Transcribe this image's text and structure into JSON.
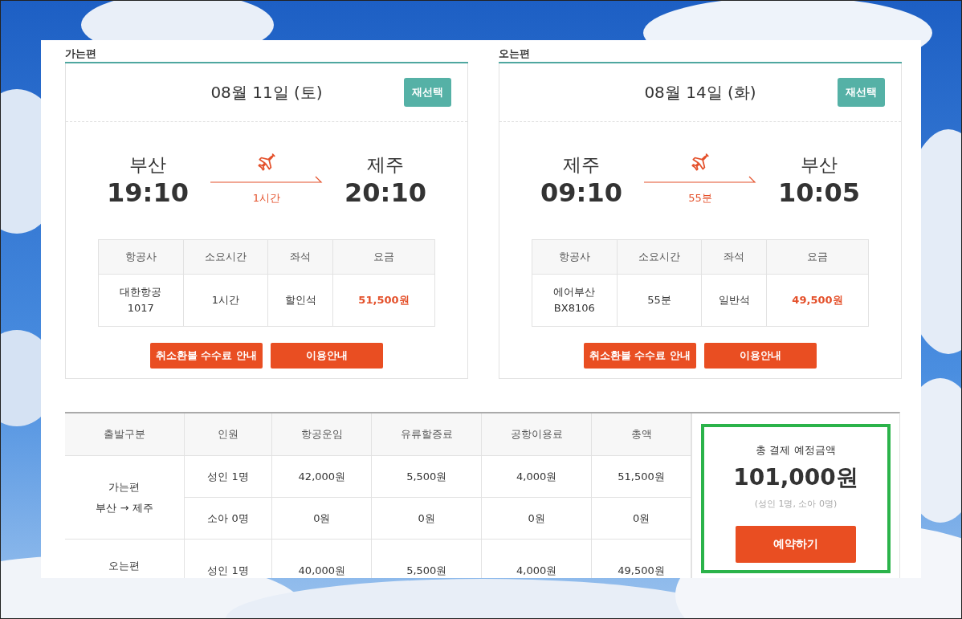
{
  "flights": [
    {
      "section_title": "가는편",
      "date": "08월 11일 (토)",
      "reselect": "재선택",
      "from": "부산",
      "dep_time": "19:10",
      "duration": "1시간",
      "to": "제주",
      "arr_time": "20:10",
      "columns": [
        "항공사",
        "소요시간",
        "좌석",
        "요금"
      ],
      "airline": "대한항공",
      "flight_no": "1017",
      "time": "1시간",
      "seat": "할인석",
      "fare": "51,500원",
      "buttons": [
        "취소환불 수수료 안내",
        "이용안내"
      ]
    },
    {
      "section_title": "오는편",
      "date": "08월 14일 (화)",
      "reselect": "재선택",
      "from": "제주",
      "dep_time": "09:10",
      "duration": "55분",
      "to": "부산",
      "arr_time": "10:05",
      "columns": [
        "항공사",
        "소요시간",
        "좌석",
        "요금"
      ],
      "airline": "에어부산",
      "flight_no": "BX8106",
      "time": "55분",
      "seat": "일반석",
      "fare": "49,500원",
      "buttons": [
        "취소환불 수수료 안내",
        "이용안내"
      ]
    }
  ],
  "fare_table": {
    "columns": [
      "출발구분",
      "인원",
      "항공운임",
      "유류할증료",
      "공항이용료",
      "총액"
    ],
    "groups": [
      {
        "direction": "가는편",
        "route": "부산 → 제주",
        "rows": [
          [
            "성인 1명",
            "42,000원",
            "5,500원",
            "4,000원",
            "51,500원"
          ],
          [
            "소아 0명",
            "0원",
            "0원",
            "0원",
            "0원"
          ]
        ]
      },
      {
        "direction": "오는편",
        "rows": [
          [
            "성인 1명",
            "40,000원",
            "5,500원",
            "4,000원",
            "49,500원"
          ]
        ]
      }
    ]
  },
  "summary": {
    "label": "총 결제 예정금액",
    "amount": "101,000원",
    "note": "(성인 1명, 소아 0명)",
    "button": "예약하기",
    "highlighted": true
  }
}
